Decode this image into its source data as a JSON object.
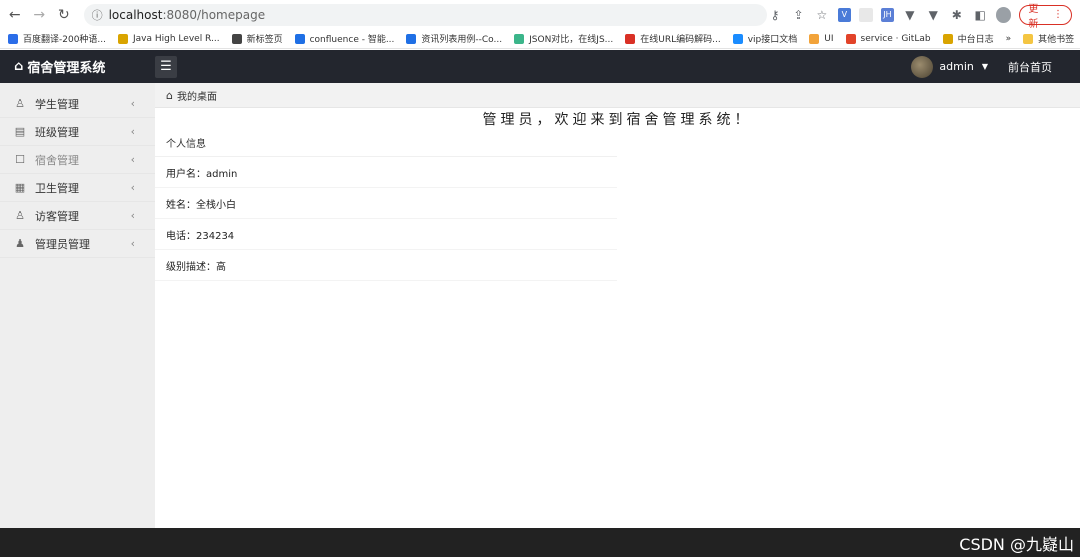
{
  "browser": {
    "url_host": "localhost",
    "url_rest": ":8080/homepage",
    "update_label": "更新"
  },
  "bookmarks": [
    {
      "label": "百度翻译-200种语...",
      "color": "#2b6de8"
    },
    {
      "label": "Java High Level R...",
      "color": "#d9a400"
    },
    {
      "label": "新标签页",
      "color": "#444444"
    },
    {
      "label": "confluence - 智能...",
      "color": "#1f6fe5"
    },
    {
      "label": "资讯列表用例--Co...",
      "color": "#1f6fe5"
    },
    {
      "label": "JSON对比，在线JS...",
      "color": "#3bb58a"
    },
    {
      "label": "在线URL编码解码...",
      "color": "#d93025"
    },
    {
      "label": "vip接口文档",
      "color": "#1a8cff"
    },
    {
      "label": "UI",
      "color": "#f2a33a"
    },
    {
      "label": "service · GitLab",
      "color": "#e24329"
    },
    {
      "label": "中台日志",
      "color": "#d9a400"
    }
  ],
  "bookmarks_more": "»",
  "bookmarks_other": "其他书签",
  "app": {
    "title": "宿舍管理系统",
    "user": "admin",
    "front_link": "前台首页"
  },
  "sidebar": {
    "items": [
      {
        "label": "学生管理",
        "icon": "user-icon"
      },
      {
        "label": "班级管理",
        "icon": "document-icon"
      },
      {
        "label": "宿舍管理",
        "icon": "bed-icon"
      },
      {
        "label": "卫生管理",
        "icon": "clipboard-icon"
      },
      {
        "label": "访客管理",
        "icon": "visitor-icon"
      },
      {
        "label": "管理员管理",
        "icon": "admin-icon"
      }
    ]
  },
  "breadcrumb": "我的桌面",
  "welcome": "管理员，欢迎来到宿舍管理系统！",
  "card": {
    "title": "个人信息",
    "rows": [
      "用户名：admin",
      "姓名：全栈小白",
      "电话：234234",
      "级别描述：高"
    ]
  },
  "watermark": "CSDN @九嶷山"
}
